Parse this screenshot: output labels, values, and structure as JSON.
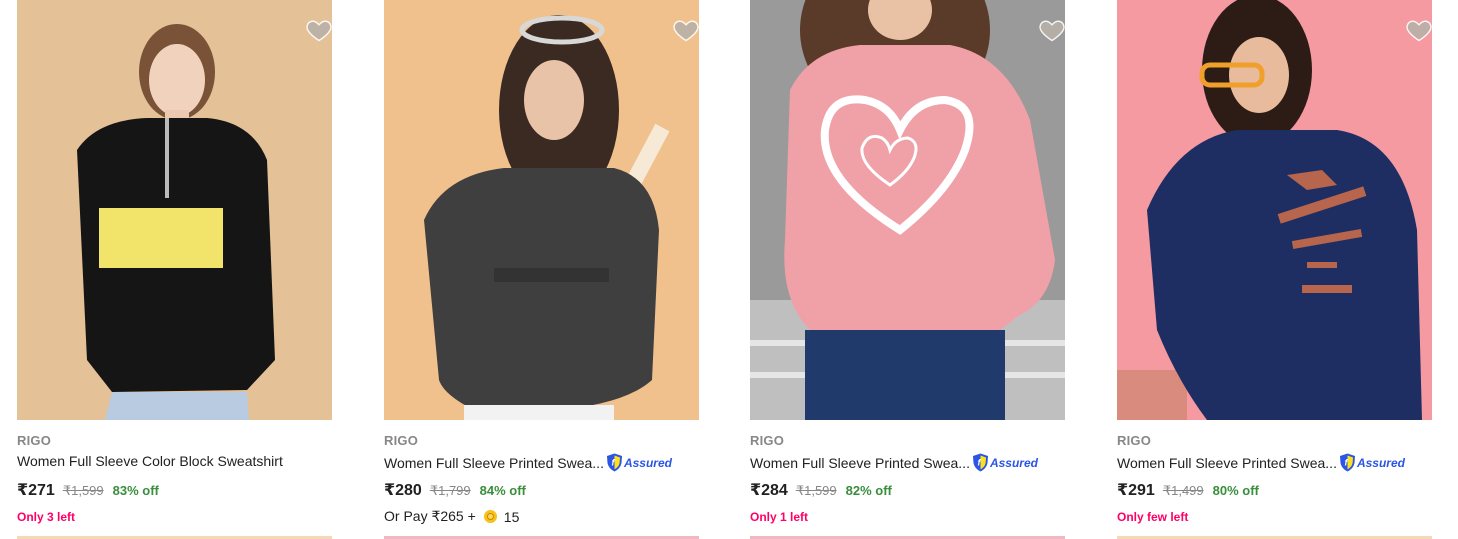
{
  "products": [
    {
      "brand": "RIGO",
      "title": "Women Full Sleeve Color Block Sweatshirt",
      "assured": false,
      "price": "₹271",
      "mrp": "₹1,599",
      "discount": "83% off",
      "stock_note": "Only 3 left",
      "wishlist_icon": "heart-icon"
    },
    {
      "brand": "RIGO",
      "title": "Women Full Sleeve Printed Swea...",
      "assured": true,
      "assured_label": "Assured",
      "price": "₹280",
      "mrp": "₹1,799",
      "discount": "84% off",
      "pay_offer": "Or Pay ₹265 +",
      "coins": "15",
      "wishlist_icon": "heart-icon"
    },
    {
      "brand": "RIGO",
      "title": "Women Full Sleeve Printed Swea...",
      "assured": true,
      "assured_label": "Assured",
      "price": "₹284",
      "mrp": "₹1,599",
      "discount": "82% off",
      "stock_note": "Only 1 left",
      "wishlist_icon": "heart-icon"
    },
    {
      "brand": "RIGO",
      "title": "Women Full Sleeve Printed Swea...",
      "assured": true,
      "assured_label": "Assured",
      "price": "₹291",
      "mrp": "₹1,499",
      "discount": "80% off",
      "stock_note": "Only few left",
      "wishlist_icon": "heart-icon"
    }
  ],
  "colors": {
    "discount_green": "#388e3c",
    "stock_pink": "#ff0066",
    "assured_blue": "#2a55e5",
    "muted_gray": "#878787"
  }
}
